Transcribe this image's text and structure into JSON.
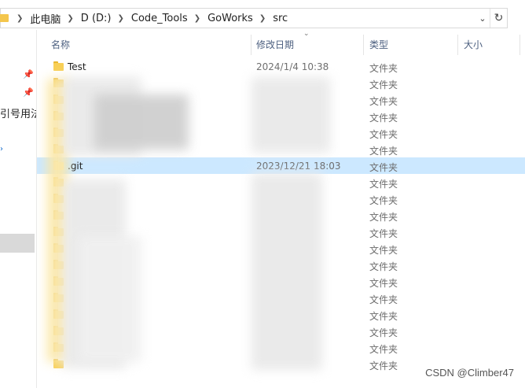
{
  "breadcrumbs": [
    "此电脑",
    "D (D:)",
    "Code_Tools",
    "GoWorks",
    "src"
  ],
  "nav_text": "引号用法",
  "columns": {
    "name": "名称",
    "modified": "修改日期",
    "type": "类型",
    "size": "大小"
  },
  "rows": [
    {
      "name": "Test",
      "date": "2024/1/4 10:38",
      "type": "文件夹"
    },
    {
      "name": "",
      "date": "",
      "type": "文件夹"
    },
    {
      "name": "",
      "date": "",
      "type": "文件夹"
    },
    {
      "name": "",
      "date": "",
      "type": "文件夹"
    },
    {
      "name": "",
      "date": "",
      "type": "文件夹"
    },
    {
      "name": "",
      "date": "",
      "type": "文件夹"
    },
    {
      "name": ".git",
      "date": "2023/12/21 18:03",
      "type": "文件夹"
    },
    {
      "name": "",
      "date": "",
      "type": "文件夹"
    },
    {
      "name": "",
      "date": "",
      "type": "文件夹"
    },
    {
      "name": "",
      "date": "",
      "type": "文件夹"
    },
    {
      "name": "",
      "date": "",
      "type": "文件夹"
    },
    {
      "name": "",
      "date": "",
      "type": "文件夹"
    },
    {
      "name": "",
      "date": "",
      "type": "文件夹"
    },
    {
      "name": "",
      "date": "",
      "type": "文件夹"
    },
    {
      "name": "",
      "date": "",
      "type": "文件夹"
    },
    {
      "name": "",
      "date": "",
      "type": "文件夹"
    },
    {
      "name": "",
      "date": "",
      "type": "文件夹"
    },
    {
      "name": "",
      "date": "",
      "type": "文件夹"
    },
    {
      "name": "",
      "date": "",
      "type": "文件夹"
    }
  ],
  "watermark": "CSDN @Climber47",
  "colors": {
    "selected_row": "#cce8ff",
    "folder": "#f8cf56",
    "header_text": "#4d6080"
  }
}
